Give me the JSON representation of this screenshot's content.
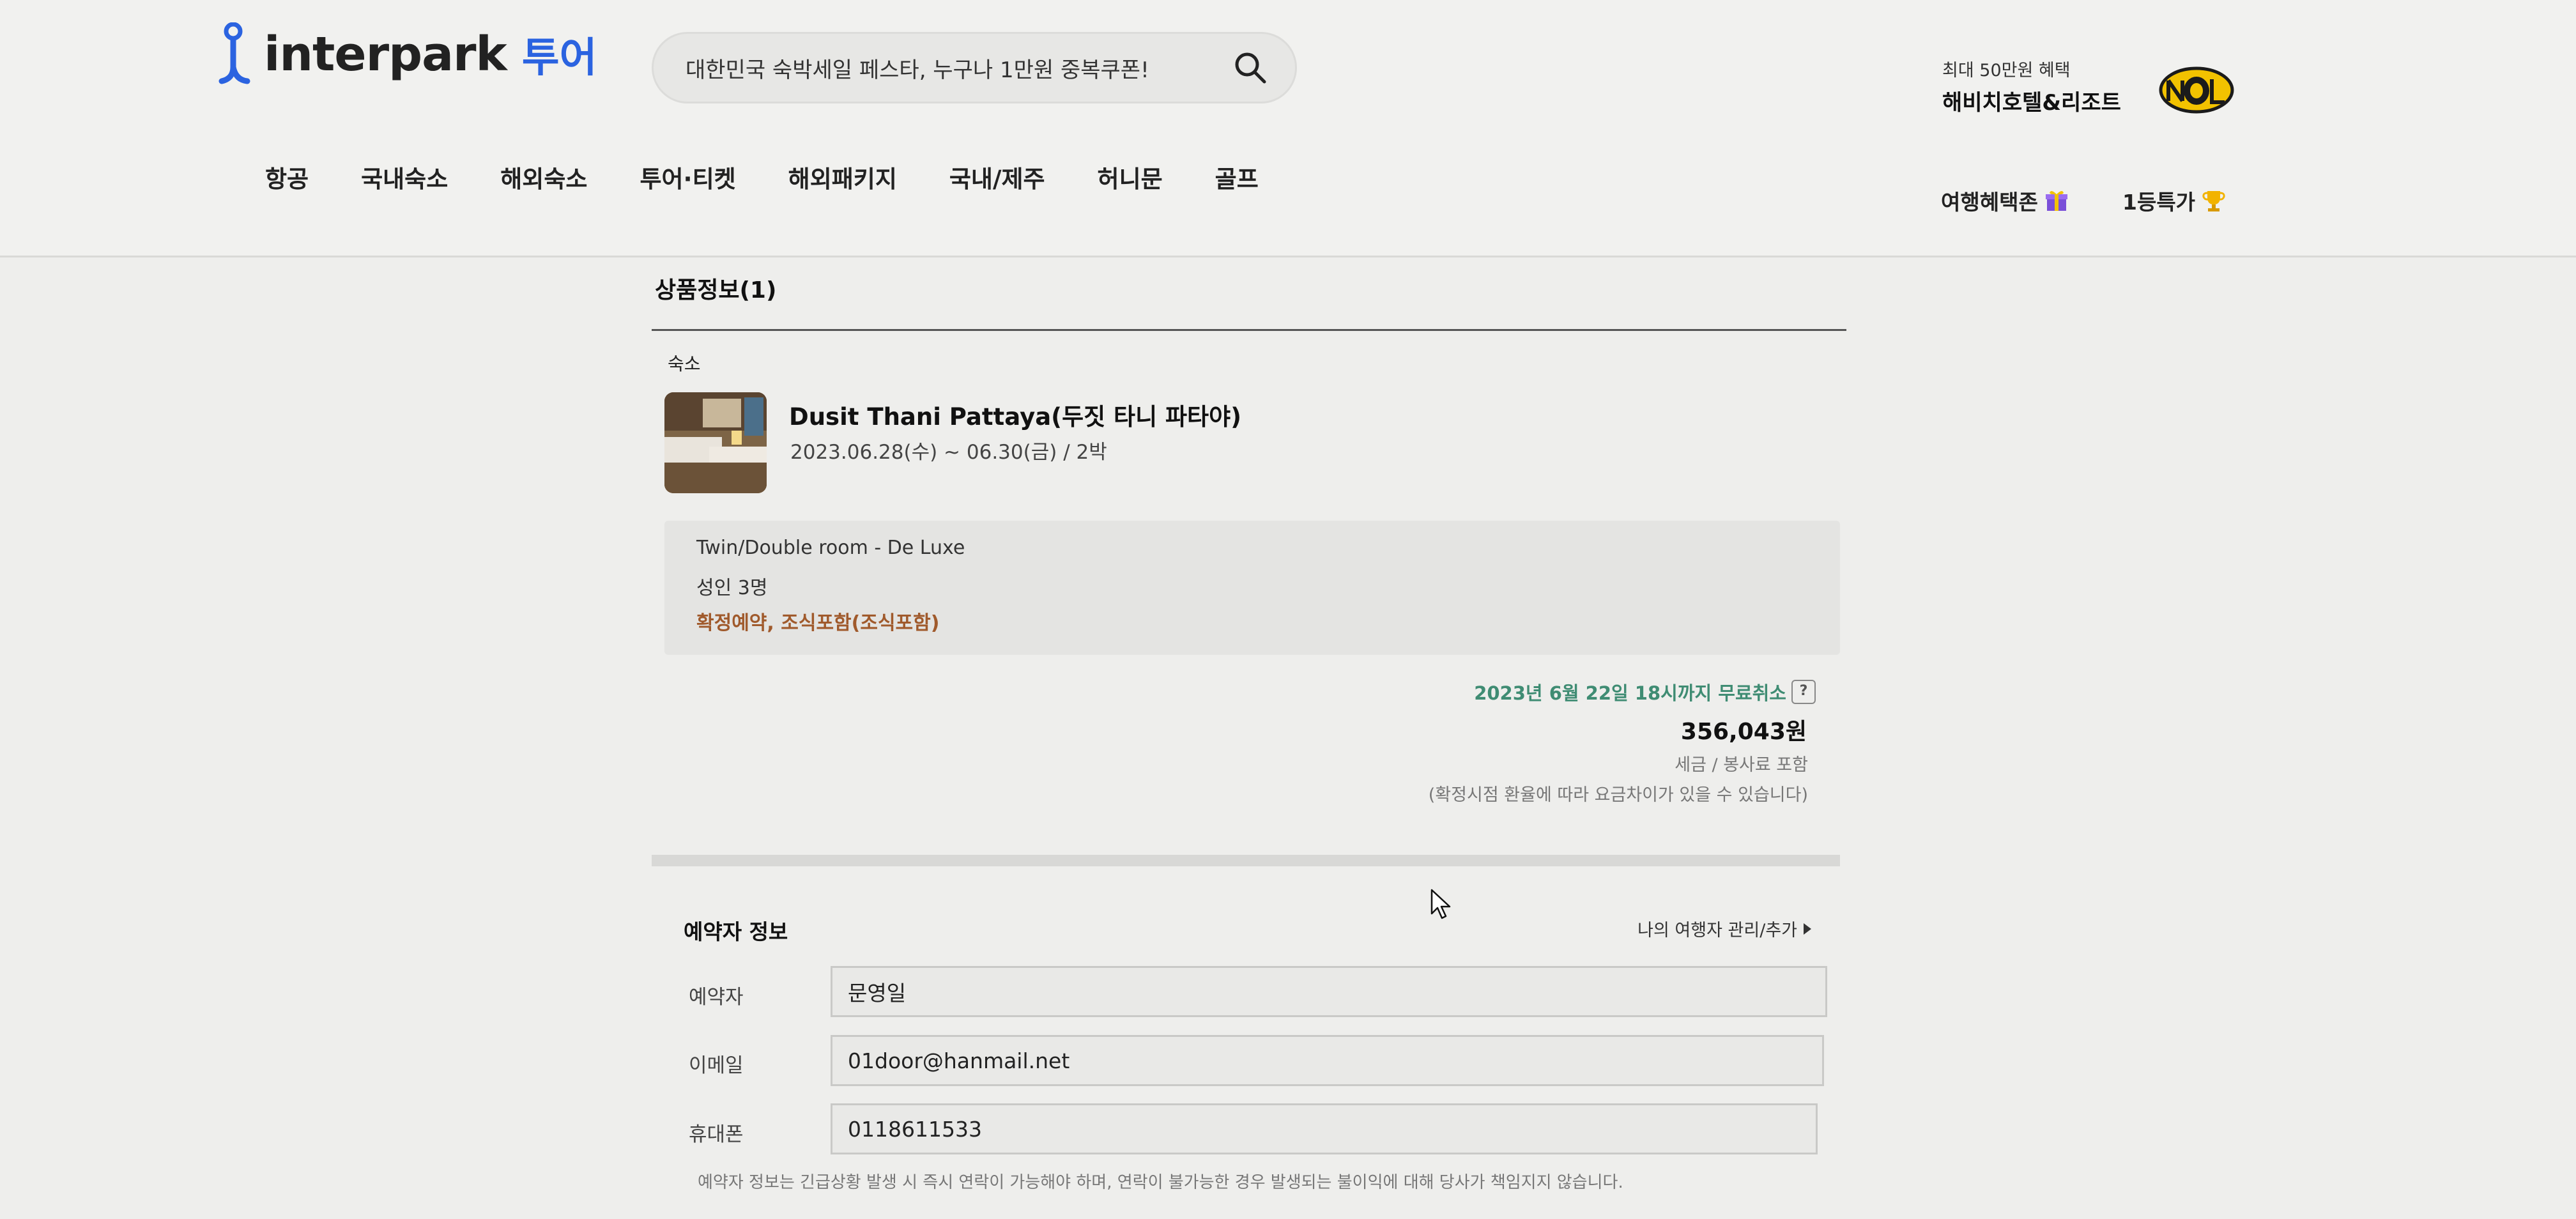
{
  "header": {
    "logo_text": "interpark",
    "logo_suffix": "투어",
    "search": {
      "placeholder": "대한민국 숙박세일 페스타, 누구나 1만원 중복쿠폰!"
    },
    "promo": {
      "top": "최대 50만원 혜택",
      "bottom": "해비치호텔&리조트"
    },
    "nav": [
      {
        "label": "항공"
      },
      {
        "label": "국내숙소"
      },
      {
        "label": "해외숙소"
      },
      {
        "label": "투어·티켓"
      },
      {
        "label": "해외패키지"
      },
      {
        "label": "국내/제주"
      },
      {
        "label": "허니문"
      },
      {
        "label": "골프"
      }
    ],
    "nav_right": [
      {
        "label": "여행혜택존"
      },
      {
        "label": "1등특가"
      }
    ]
  },
  "product": {
    "section_title": "상품정보(1)",
    "category": "숙소",
    "hotel_name": "Dusit Thani Pattaya(두짓 타니 파타야)",
    "dates": "2023.06.28(수) ~ 06.30(금) / 2박",
    "room": "Twin/Double room - De Luxe",
    "guests": "성인 3명",
    "conditions": "확정예약, 조식포함(조식포함)",
    "cancel_policy": "2023년 6월 22일 18시까지 무료취소",
    "cancel_help": "?",
    "price": "356,043원",
    "tax_note": "세금 / 봉사료 포함",
    "fx_note": "(확정시점 환율에 따라 요금차이가 있을 수 있습니다)"
  },
  "booker": {
    "title": "예약자 정보",
    "traveler_link": "나의 여행자 관리/추가",
    "fields": [
      {
        "label": "예약자",
        "value": "문영일"
      },
      {
        "label": "이메일",
        "value": "01door@hanmail.net"
      },
      {
        "label": "휴대폰",
        "value": "0118611533"
      }
    ],
    "notice": "예약자 정보는 긴급상황 발생 시 즉시 연락이 가능해야 하며, 연락이 불가능한 경우 발생되는 불이익에 대해 당사가 책임지지 않습니다."
  },
  "colors": {
    "brand_blue": "#2b63e0",
    "cancel_green": "#3f8c73",
    "highlight_brown": "#a05a2c"
  }
}
